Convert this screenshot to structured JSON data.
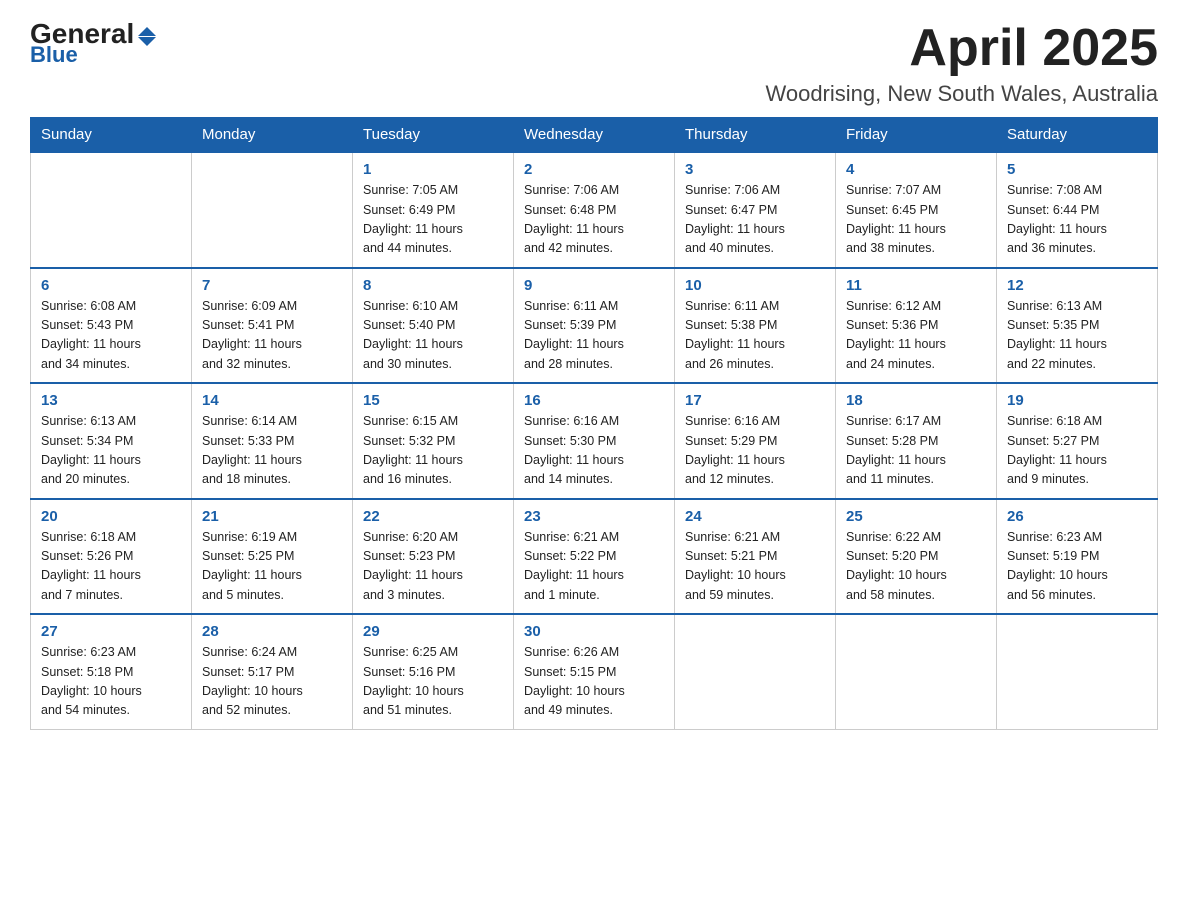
{
  "logo": {
    "general": "General",
    "blue": "Blue",
    "triangle": "▶"
  },
  "title": "April 2025",
  "location": "Woodrising, New South Wales, Australia",
  "weekdays": [
    "Sunday",
    "Monday",
    "Tuesday",
    "Wednesday",
    "Thursday",
    "Friday",
    "Saturday"
  ],
  "weeks": [
    [
      {
        "day": "",
        "info": ""
      },
      {
        "day": "",
        "info": ""
      },
      {
        "day": "1",
        "info": "Sunrise: 7:05 AM\nSunset: 6:49 PM\nDaylight: 11 hours\nand 44 minutes."
      },
      {
        "day": "2",
        "info": "Sunrise: 7:06 AM\nSunset: 6:48 PM\nDaylight: 11 hours\nand 42 minutes."
      },
      {
        "day": "3",
        "info": "Sunrise: 7:06 AM\nSunset: 6:47 PM\nDaylight: 11 hours\nand 40 minutes."
      },
      {
        "day": "4",
        "info": "Sunrise: 7:07 AM\nSunset: 6:45 PM\nDaylight: 11 hours\nand 38 minutes."
      },
      {
        "day": "5",
        "info": "Sunrise: 7:08 AM\nSunset: 6:44 PM\nDaylight: 11 hours\nand 36 minutes."
      }
    ],
    [
      {
        "day": "6",
        "info": "Sunrise: 6:08 AM\nSunset: 5:43 PM\nDaylight: 11 hours\nand 34 minutes."
      },
      {
        "day": "7",
        "info": "Sunrise: 6:09 AM\nSunset: 5:41 PM\nDaylight: 11 hours\nand 32 minutes."
      },
      {
        "day": "8",
        "info": "Sunrise: 6:10 AM\nSunset: 5:40 PM\nDaylight: 11 hours\nand 30 minutes."
      },
      {
        "day": "9",
        "info": "Sunrise: 6:11 AM\nSunset: 5:39 PM\nDaylight: 11 hours\nand 28 minutes."
      },
      {
        "day": "10",
        "info": "Sunrise: 6:11 AM\nSunset: 5:38 PM\nDaylight: 11 hours\nand 26 minutes."
      },
      {
        "day": "11",
        "info": "Sunrise: 6:12 AM\nSunset: 5:36 PM\nDaylight: 11 hours\nand 24 minutes."
      },
      {
        "day": "12",
        "info": "Sunrise: 6:13 AM\nSunset: 5:35 PM\nDaylight: 11 hours\nand 22 minutes."
      }
    ],
    [
      {
        "day": "13",
        "info": "Sunrise: 6:13 AM\nSunset: 5:34 PM\nDaylight: 11 hours\nand 20 minutes."
      },
      {
        "day": "14",
        "info": "Sunrise: 6:14 AM\nSunset: 5:33 PM\nDaylight: 11 hours\nand 18 minutes."
      },
      {
        "day": "15",
        "info": "Sunrise: 6:15 AM\nSunset: 5:32 PM\nDaylight: 11 hours\nand 16 minutes."
      },
      {
        "day": "16",
        "info": "Sunrise: 6:16 AM\nSunset: 5:30 PM\nDaylight: 11 hours\nand 14 minutes."
      },
      {
        "day": "17",
        "info": "Sunrise: 6:16 AM\nSunset: 5:29 PM\nDaylight: 11 hours\nand 12 minutes."
      },
      {
        "day": "18",
        "info": "Sunrise: 6:17 AM\nSunset: 5:28 PM\nDaylight: 11 hours\nand 11 minutes."
      },
      {
        "day": "19",
        "info": "Sunrise: 6:18 AM\nSunset: 5:27 PM\nDaylight: 11 hours\nand 9 minutes."
      }
    ],
    [
      {
        "day": "20",
        "info": "Sunrise: 6:18 AM\nSunset: 5:26 PM\nDaylight: 11 hours\nand 7 minutes."
      },
      {
        "day": "21",
        "info": "Sunrise: 6:19 AM\nSunset: 5:25 PM\nDaylight: 11 hours\nand 5 minutes."
      },
      {
        "day": "22",
        "info": "Sunrise: 6:20 AM\nSunset: 5:23 PM\nDaylight: 11 hours\nand 3 minutes."
      },
      {
        "day": "23",
        "info": "Sunrise: 6:21 AM\nSunset: 5:22 PM\nDaylight: 11 hours\nand 1 minute."
      },
      {
        "day": "24",
        "info": "Sunrise: 6:21 AM\nSunset: 5:21 PM\nDaylight: 10 hours\nand 59 minutes."
      },
      {
        "day": "25",
        "info": "Sunrise: 6:22 AM\nSunset: 5:20 PM\nDaylight: 10 hours\nand 58 minutes."
      },
      {
        "day": "26",
        "info": "Sunrise: 6:23 AM\nSunset: 5:19 PM\nDaylight: 10 hours\nand 56 minutes."
      }
    ],
    [
      {
        "day": "27",
        "info": "Sunrise: 6:23 AM\nSunset: 5:18 PM\nDaylight: 10 hours\nand 54 minutes."
      },
      {
        "day": "28",
        "info": "Sunrise: 6:24 AM\nSunset: 5:17 PM\nDaylight: 10 hours\nand 52 minutes."
      },
      {
        "day": "29",
        "info": "Sunrise: 6:25 AM\nSunset: 5:16 PM\nDaylight: 10 hours\nand 51 minutes."
      },
      {
        "day": "30",
        "info": "Sunrise: 6:26 AM\nSunset: 5:15 PM\nDaylight: 10 hours\nand 49 minutes."
      },
      {
        "day": "",
        "info": ""
      },
      {
        "day": "",
        "info": ""
      },
      {
        "day": "",
        "info": ""
      }
    ]
  ]
}
